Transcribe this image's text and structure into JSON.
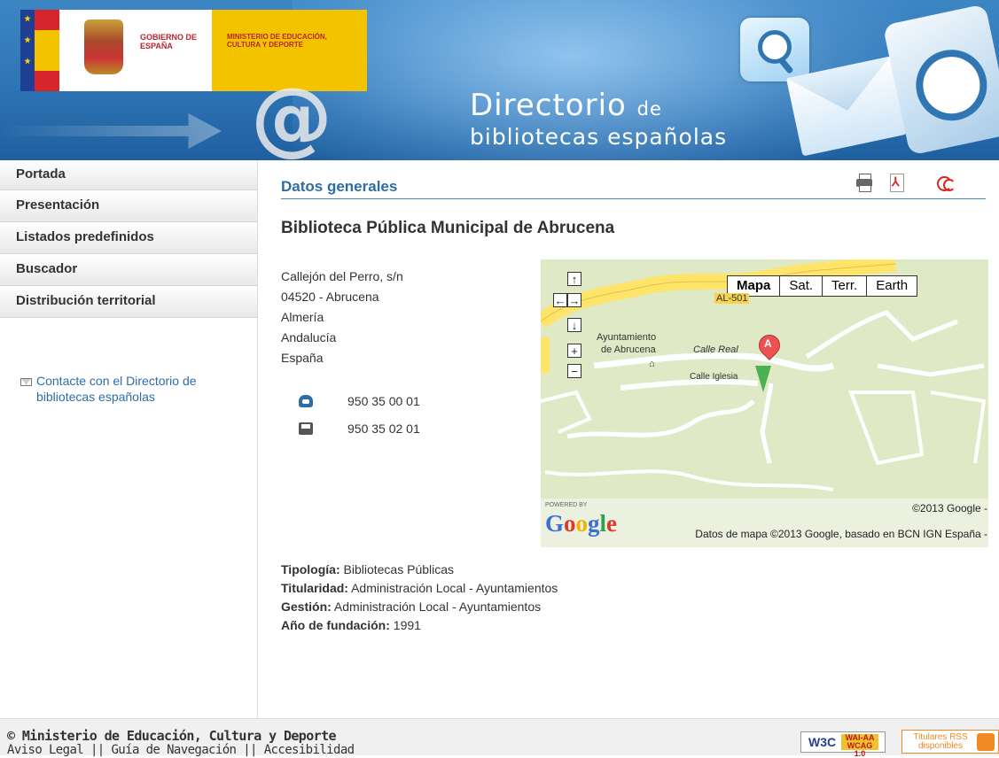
{
  "header": {
    "gobierno": "GOBIERNO DE ESPAÑA",
    "ministerio": "MINISTERIO DE EDUCACIÓN, CULTURA Y DEPORTE",
    "title_line1": "Directorio",
    "title_de": "de",
    "title_line2": "bibliotecas españolas"
  },
  "sidebar": {
    "items": [
      {
        "label": "Portada"
      },
      {
        "label": "Presentación"
      },
      {
        "label": "Listados predefinidos"
      },
      {
        "label": "Buscador"
      },
      {
        "label": "Distribución territorial"
      }
    ],
    "contact_label": "Contacte con el Directorio de bibliotecas españolas"
  },
  "main": {
    "section_title": "Datos generales",
    "library_name": "Biblioteca Pública Municipal de Abrucena",
    "address": {
      "street": "Callejón del Perro, s/n",
      "postal_city": "04520 - Abrucena",
      "province": "Almería",
      "region": "Andalucía",
      "country": "España"
    },
    "phone": "950 35 00 01",
    "fax": "950 35 02 01",
    "tipologia_label": "Tipología:",
    "tipologia_value": "Bibliotecas Públicas",
    "titularidad_label": "Titularidad:",
    "titularidad_value": "Administración Local - Ayuntamientos",
    "gestion_label": "Gestión:",
    "gestion_value": "Administración Local - Ayuntamientos",
    "fundacion_label": "Año de fundación:",
    "fundacion_value": "1991"
  },
  "map": {
    "types": [
      "Mapa",
      "Sat.",
      "Terr.",
      "Earth"
    ],
    "active_type": "Mapa",
    "controls": {
      "up": "↑",
      "left": "←",
      "right": "→",
      "down": "↓",
      "zoom_in": "+",
      "zoom_out": "−"
    },
    "labels": {
      "ayuntamiento": "Ayuntamiento",
      "de_abrucena": "de Abrucena",
      "calle_real": "Calle Real",
      "calle_iglesia": "Calle Iglesia",
      "road_badge": "AL-501"
    },
    "marker": "A",
    "powered_by": "POWERED BY",
    "google": "Google",
    "copyright1": "©2013 Google -",
    "copyright2": "Datos de mapa ©2013 Google, basado en BCN IGN España -"
  },
  "footer": {
    "copyright": "© Ministerio de Educación, Cultura y Deporte",
    "links": [
      "Aviso Legal",
      "Guía de Navegación",
      "Accesibilidad"
    ],
    "w3c": "W3C",
    "wai": "WAI-AA WCAG 1.0",
    "rss": "Titulares RSS disponibles"
  },
  "colors": {
    "accent": "#2e6da4",
    "header_blue": "#2d74b4",
    "yellow": "#f4c300",
    "red": "#d7262b"
  }
}
